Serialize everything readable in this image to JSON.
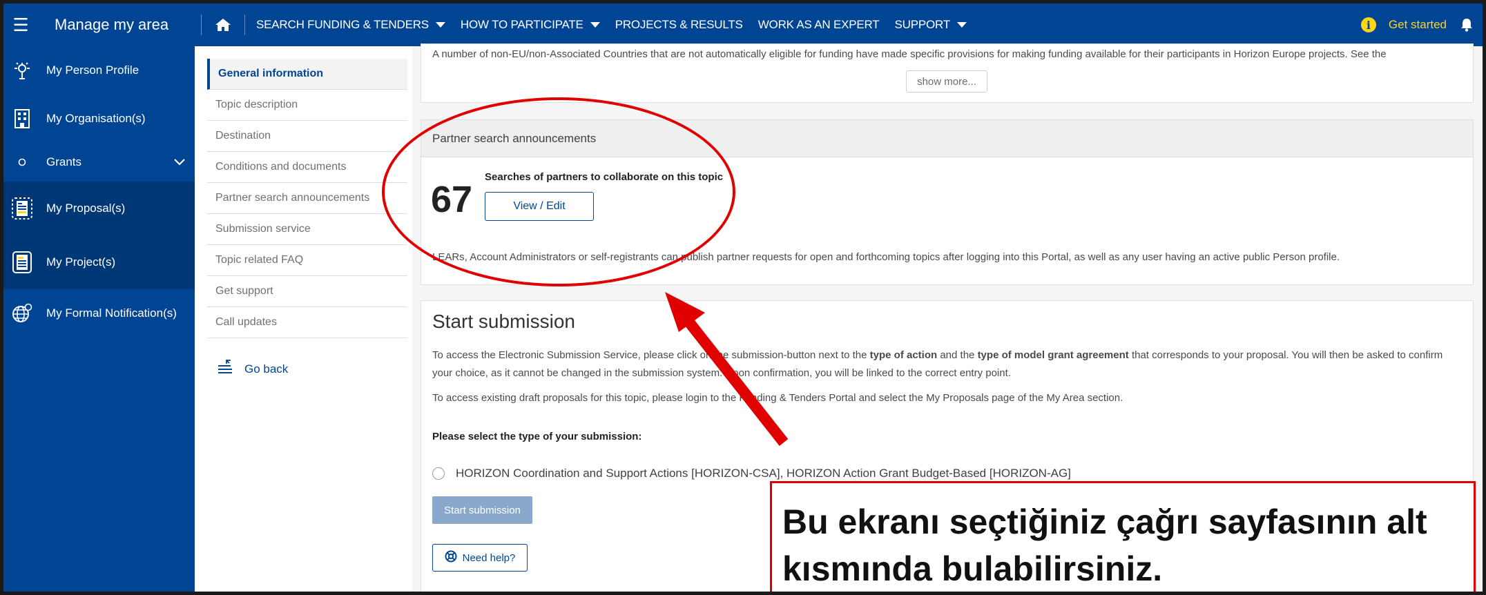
{
  "topbar": {
    "app_title": "Manage my area",
    "nav": [
      {
        "label": "SEARCH FUNDING & TENDERS",
        "has_caret": true
      },
      {
        "label": "HOW TO PARTICIPATE",
        "has_caret": true
      },
      {
        "label": "PROJECTS & RESULTS",
        "has_caret": false
      },
      {
        "label": "WORK AS AN EXPERT",
        "has_caret": false
      },
      {
        "label": "SUPPORT",
        "has_caret": true
      }
    ],
    "get_started": "Get started"
  },
  "sidebar": {
    "items": [
      {
        "label": "My Person Profile",
        "icon": "person-profile-icon"
      },
      {
        "label": "My Organisation(s)",
        "icon": "building-icon"
      },
      {
        "label": "Grants",
        "icon": "circle-icon"
      },
      {
        "label": "My Proposal(s)",
        "icon": "proposal-icon"
      },
      {
        "label": "My Project(s)",
        "icon": "project-icon"
      },
      {
        "label": "My Formal Notification(s)",
        "icon": "globe-icon"
      }
    ]
  },
  "subnav": {
    "items": [
      "General information",
      "Topic description",
      "Destination",
      "Conditions and documents",
      "Partner search announcements",
      "Submission service",
      "Topic related FAQ",
      "Get support",
      "Call updates"
    ],
    "go_back": "Go back"
  },
  "top_panel": {
    "description": "A number of non-EU/non-Associated Countries that are not automatically eligible for funding have made specific provisions for making funding available for their participants in Horizon Europe projects. See the",
    "show_more": "show more..."
  },
  "partner_search": {
    "header": "Partner search announcements",
    "count": "67",
    "caption": "Searches of partners to collaborate on this topic",
    "button": "View / Edit",
    "note": "LEARs, Account Administrators or self-registrants can publish partner requests for open and forthcoming topics after logging into this Portal, as well as any user having an active public Person profile."
  },
  "submission": {
    "title": "Start submission",
    "p1_a": "To access the Electronic Submission Service, please click on the submission-button next to the ",
    "p1_b": "type of action",
    "p1_c": " and the ",
    "p1_d": "type of model grant agreement",
    "p1_e": " that corresponds to your proposal. You will then be asked to confirm your choice, as it cannot be changed in the submission system. Upon confirmation, you will be linked to the correct entry point.",
    "p2": "To access existing draft proposals for this topic, please login to the Funding & Tenders Portal and select the My Proposals page of the My Area section.",
    "select_label": "Please select the type of your submission:",
    "option": "HORIZON Coordination and Support Actions [HORIZON-CSA], HORIZON Action Grant Budget-Based [HORIZON-AG]",
    "start_button": "Start submission",
    "help_button": "Need help?"
  },
  "callout": {
    "line1": "Bu ekranı seçtiğiniz çağrı sayfasının alt",
    "line2": "kısmında bulabilirsiniz."
  },
  "colors": {
    "brand_blue": "#004494",
    "accent_yellow": "#ffd617",
    "annotation_red": "#e00000"
  }
}
